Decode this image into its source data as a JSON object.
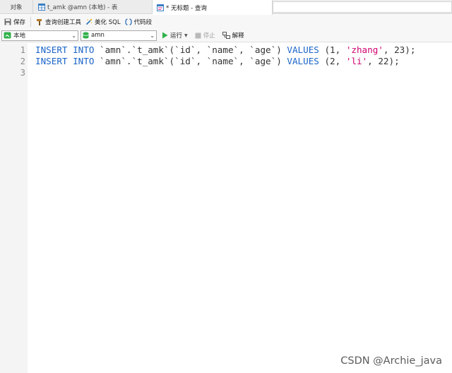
{
  "tabs": [
    {
      "label": "对象"
    },
    {
      "label": "t_amk @amn (本地) - 表"
    },
    {
      "label": "* 无标题 - 查询"
    }
  ],
  "toolbar": {
    "save": "保存",
    "query_builder": "查询创建工具",
    "beautify_sql": "美化 SQL",
    "code_snippet": "代码段"
  },
  "querybar": {
    "connection": "本地",
    "database": "amn",
    "run": "运行",
    "stop": "停止",
    "explain": "解释"
  },
  "editor": {
    "lines": [
      {
        "number": "1",
        "kw1": "INSERT INTO",
        "target": " `amn`.`t_amk`(`id`, `name`, `age`) ",
        "kw2": "VALUES",
        "open": " (",
        "v1": "1",
        "sep1": ", ",
        "v2": "'zhang'",
        "sep2": ", ",
        "v3": "23",
        "close": ");"
      },
      {
        "number": "2",
        "kw1": "INSERT INTO",
        "target": " `amn`.`t_amk`(`id`, `name`, `age`) ",
        "kw2": "VALUES",
        "open": " (",
        "v1": "2",
        "sep1": ", ",
        "v2": "'li'",
        "sep2": ", ",
        "v3": "22",
        "close": ");"
      },
      {
        "number": "3"
      }
    ]
  },
  "watermark": "CSDN @Archie_java",
  "colors": {
    "keyword": "#1a64c8",
    "string": "#d0006f",
    "run_green": "#2fb14a"
  }
}
